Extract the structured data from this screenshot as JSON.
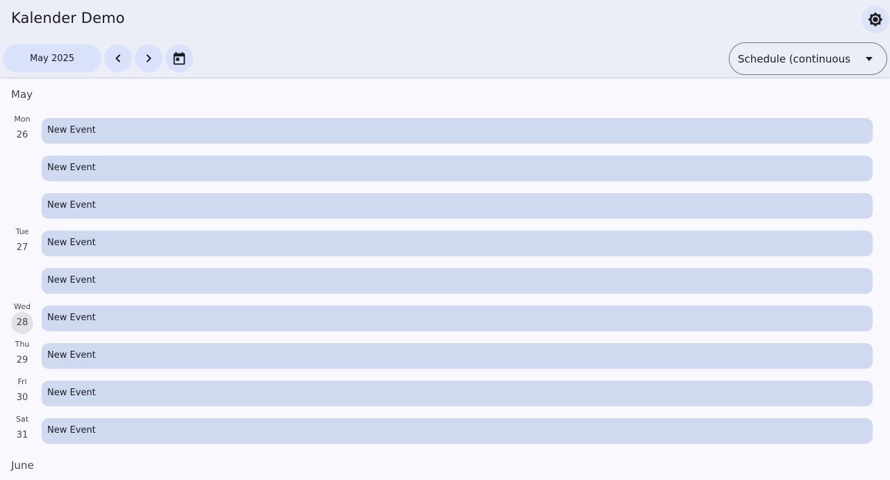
{
  "app": {
    "title": "Kalender Demo"
  },
  "toolbar": {
    "month_button": "May 2025",
    "prev_icon": "chevron-left-icon",
    "next_icon": "chevron-right-icon",
    "today_icon": "calendar-today-icon",
    "theme_icon": "brightness-icon",
    "view_select": "Schedule (continuous"
  },
  "schedule": {
    "months": [
      "May",
      "June"
    ],
    "days": [
      {
        "dow": "Mon",
        "dom": "26"
      },
      {
        "dow": "Tue",
        "dom": "27"
      },
      {
        "dow": "Wed",
        "dom": "28",
        "today": true
      },
      {
        "dow": "Thu",
        "dom": "29"
      },
      {
        "dow": "Fri",
        "dom": "30"
      },
      {
        "dow": "Sat",
        "dom": "31"
      }
    ],
    "events": [
      {
        "title": "New Event"
      },
      {
        "title": "New Event"
      },
      {
        "title": "New Event"
      },
      {
        "title": "New Event"
      },
      {
        "title": "New Event"
      },
      {
        "title": "New Event"
      },
      {
        "title": "New Event"
      },
      {
        "title": "New Event"
      },
      {
        "title": "New Event"
      }
    ]
  },
  "colors": {
    "accent": "#d9e2fa",
    "event": "#cfd9f0",
    "topbar": "#ebeef7",
    "background": "#f9f8ff"
  }
}
